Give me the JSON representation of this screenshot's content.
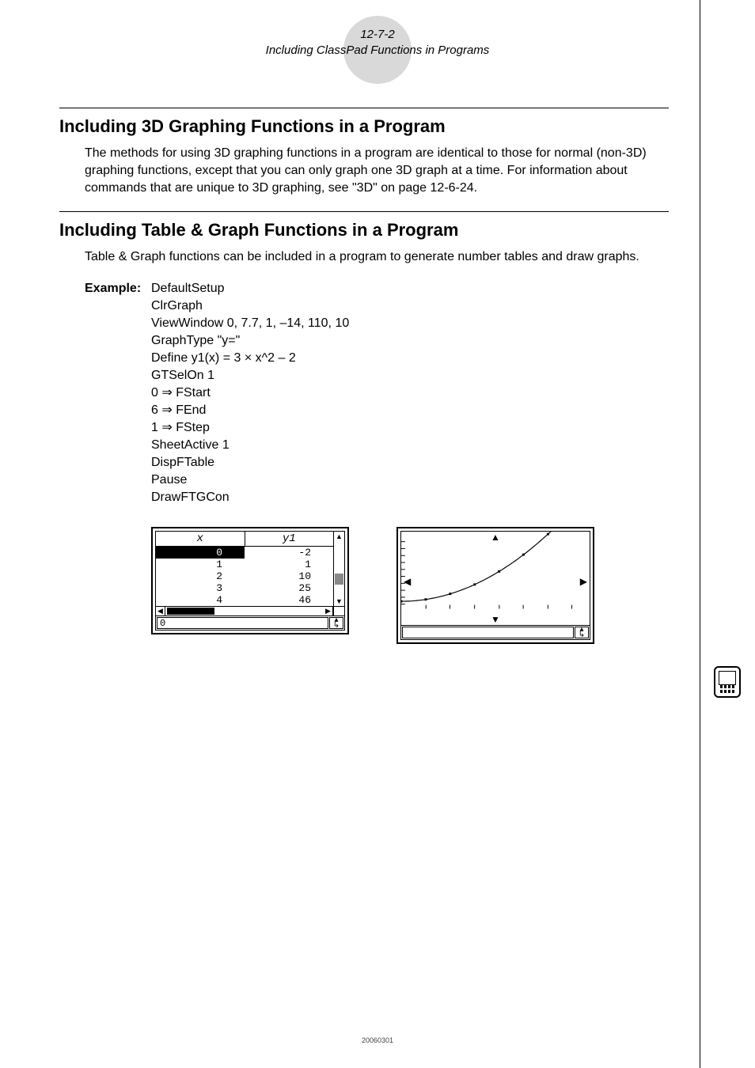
{
  "header": {
    "page_num": "12-7-2",
    "chapter": "Including ClassPad Functions in Programs"
  },
  "sec1": {
    "heading": "Including 3D Graphing Functions in a Program",
    "body": "The methods for using 3D graphing functions in a program are identical to those for normal (non-3D) graphing functions, except that you can only graph one 3D graph at a time. For information about commands that are unique to 3D graphing, see \"3D\" on page 12-6-24."
  },
  "sec2": {
    "heading": "Including Table & Graph Functions in a Program",
    "body": "Table & Graph functions can be included in a program to generate number tables and draw graphs.",
    "example_label": "Example:",
    "code": {
      "l0": "DefaultSetup",
      "l1": "ClrGraph",
      "l2": "ViewWindow 0, 7.7, 1, –14, 110, 10",
      "l3": "GraphType \"y=\"",
      "l4_a": "Define y1(x) = 3 ",
      "l4_b": "×",
      "l4_c": " x^2 – 2",
      "l5": "GTSelOn 1",
      "l6_a": "0 ",
      "l6_b": "⇒",
      "l6_c": " FStart",
      "l7_a": "6 ",
      "l7_b": "⇒",
      "l7_c": " FEnd",
      "l8_a": "1 ",
      "l8_b": "⇒",
      "l8_c": " FStep",
      "l9": "SheetActive 1",
      "l10": "DispFTable",
      "l11": "Pause",
      "l12": "DrawFTGCon"
    }
  },
  "table_fig": {
    "col1": "x",
    "col2": "y1",
    "rows": [
      {
        "x": "0",
        "y": "-2"
      },
      {
        "x": "1",
        "y": "1"
      },
      {
        "x": "2",
        "y": "10"
      },
      {
        "x": "3",
        "y": "25"
      },
      {
        "x": "4",
        "y": "46"
      }
    ],
    "status": "0",
    "arrows": {
      "up": "▲",
      "down": "▼",
      "left": "◀",
      "right": "▶"
    },
    "status_icon_top": "▴",
    "status_icon_bot": "↳"
  },
  "graph_fig": {
    "arrows": {
      "up": "▲",
      "down": "▼",
      "left": "◀",
      "right": "▶"
    },
    "status_icon_top": "▴",
    "status_icon_bot": "↳"
  },
  "chart_data": {
    "type": "line",
    "x": [
      0,
      1,
      2,
      3,
      4,
      5,
      6
    ],
    "y": [
      -2,
      1,
      10,
      25,
      46,
      73,
      106
    ],
    "xlabel": "",
    "ylabel": "",
    "xlim": [
      0,
      7.7
    ],
    "ylim": [
      -14,
      110
    ],
    "markers": true
  },
  "footer": {
    "code": "20060301"
  },
  "side_icon": {
    "name": "calculator-icon"
  }
}
